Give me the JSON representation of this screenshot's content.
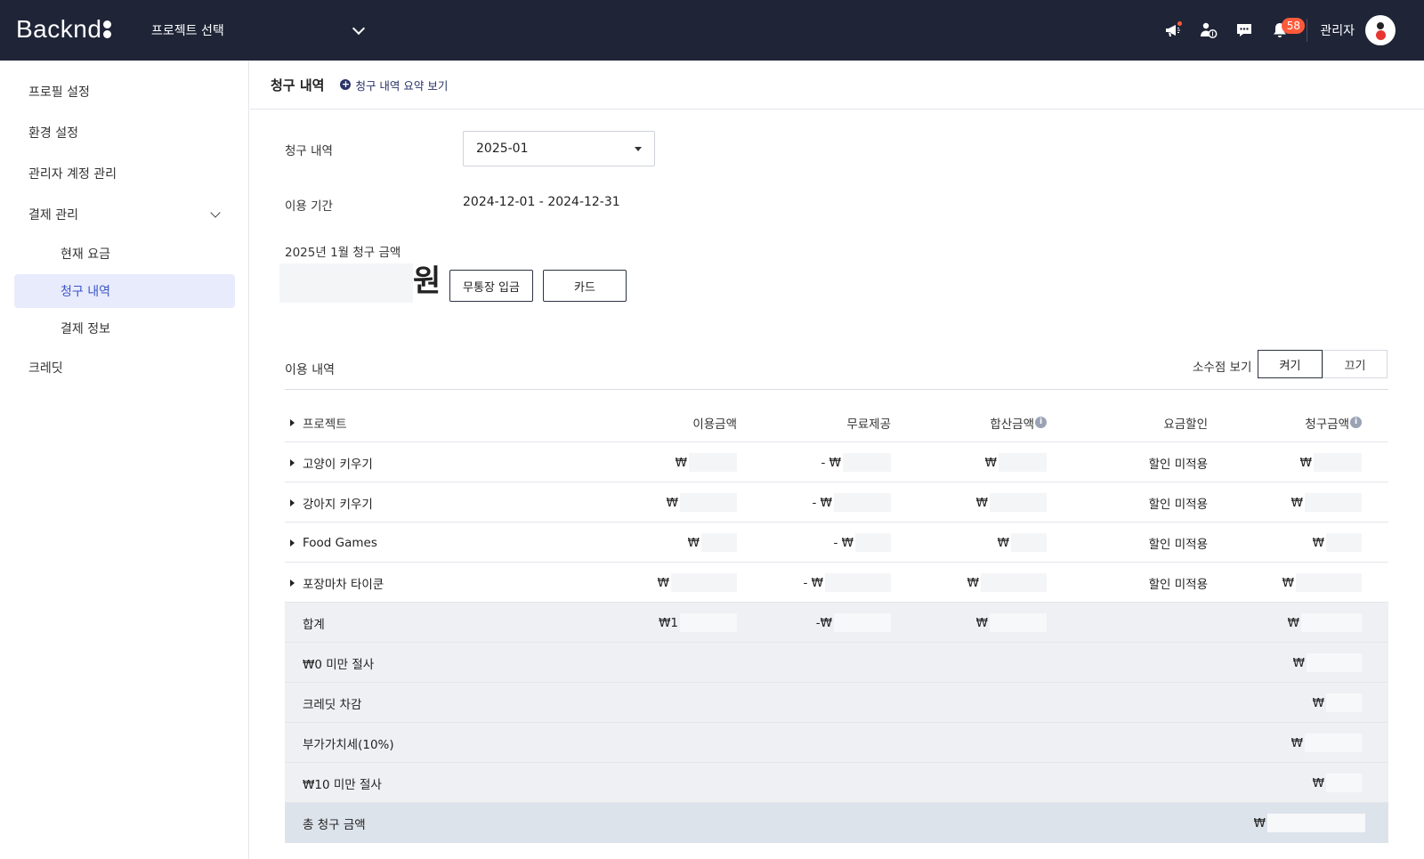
{
  "topbar": {
    "logo": "Backnd",
    "project_select": "프로젝트 선택",
    "notification_count": "58",
    "admin_label": "관리자",
    "icons": [
      "megaphone-icon",
      "dollar-person-icon",
      "chat-icon",
      "bell-icon"
    ]
  },
  "sidebar": {
    "items": [
      {
        "label": "프로필 설정"
      },
      {
        "label": "환경 설정"
      },
      {
        "label": "관리자 계정 관리"
      },
      {
        "label": "결제 관리"
      },
      {
        "label": "현재 요금"
      },
      {
        "label": "청구 내역"
      },
      {
        "label": "결제 정보"
      },
      {
        "label": "크레딧"
      }
    ]
  },
  "header": {
    "title": "청구 내역",
    "summary_link": "청구 내역 요약 보기"
  },
  "form": {
    "billing_label": "청구 내역",
    "billing_month": "2025-01",
    "period_label": "이용 기간",
    "period_value": "2024-12-01 - 2024-12-31",
    "amount_label": "2025년 1월 청구 금액",
    "currency_unit": "원",
    "bank_button": "무통장 입금",
    "card_button": "카드"
  },
  "usage": {
    "title": "이용 내역",
    "decimal_label": "소수점 보기",
    "toggle_on": "켜기",
    "toggle_off": "끄기"
  },
  "table": {
    "headers": {
      "project": "프로젝트",
      "usage": "이용금액",
      "free": "무료제공",
      "subtotal": "합산금액",
      "discount": "요금할인",
      "billed": "청구금액"
    },
    "rows": [
      {
        "name": "고양이 키우기",
        "usage": "₩",
        "free": "- ₩",
        "subtotal": "₩",
        "discount": "할인 미적용",
        "billed": "₩"
      },
      {
        "name": "강아지 키우기",
        "usage": "₩",
        "free": "- ₩",
        "subtotal": "₩",
        "discount": "할인 미적용",
        "billed": "₩"
      },
      {
        "name": "Food Games",
        "usage": "₩",
        "free": "- ₩",
        "subtotal": "₩",
        "discount": "할인 미적용",
        "billed": "₩"
      },
      {
        "name": "포장마차 타이쿤",
        "usage": "₩",
        "free": "- ₩",
        "subtotal": "₩",
        "discount": "할인 미적용",
        "billed": "₩"
      }
    ],
    "summary": {
      "total_label": "합계",
      "total_usage": "₩1",
      "total_free": "-₩",
      "total_subtotal": "₩",
      "total_billed": "₩",
      "floor0_label": "₩0 미만 절사",
      "floor0_value": "₩",
      "credit_label": "크레딧 차감",
      "credit_value": "₩",
      "vat_label": "부가가치세(10%)",
      "vat_value": "₩",
      "floor10_label": "₩10 미만 절사",
      "floor10_value": "₩",
      "grand_label": "총 청구 금액",
      "grand_value": "₩"
    }
  }
}
